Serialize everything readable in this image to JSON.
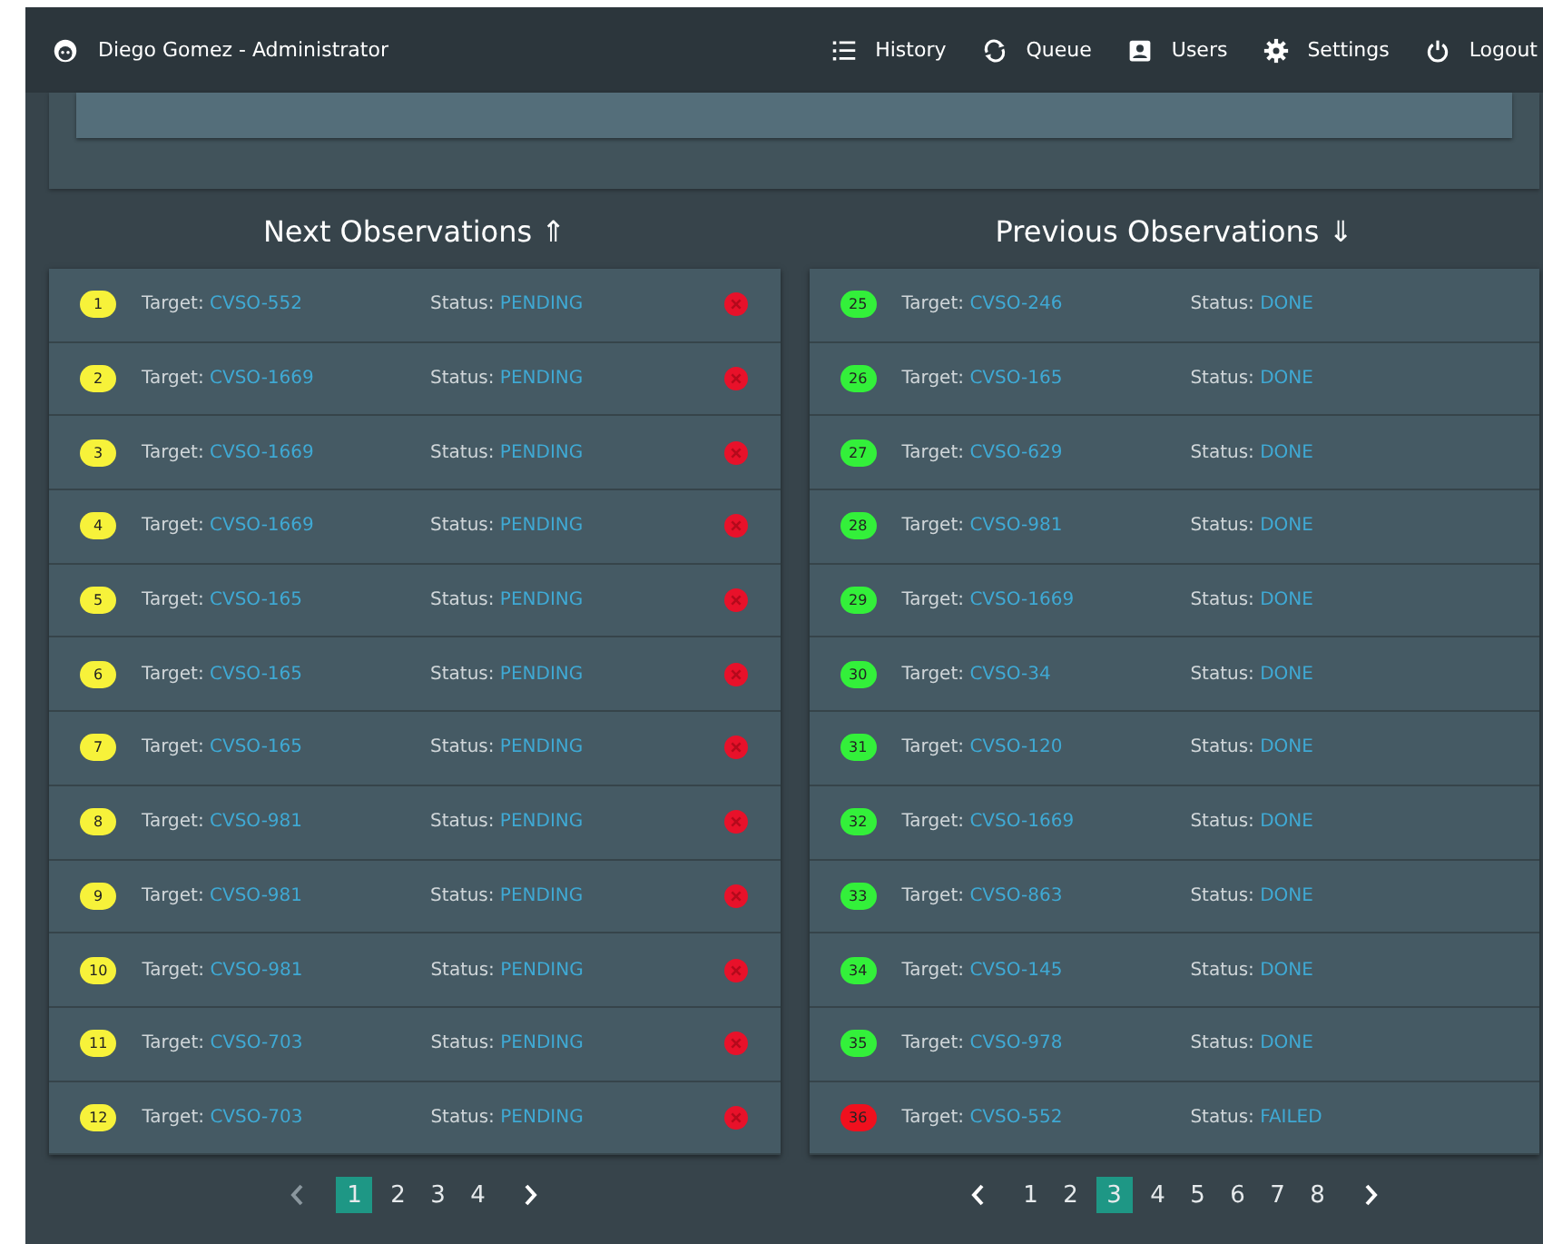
{
  "header": {
    "user": "Diego Gomez - Administrator",
    "nav": [
      {
        "label": "History"
      },
      {
        "label": "Queue"
      },
      {
        "label": "Users"
      },
      {
        "label": "Settings"
      },
      {
        "label": "Logout"
      }
    ]
  },
  "lists": [
    {
      "title": "Next Observations ⇑",
      "cancelable": true,
      "rows": [
        {
          "number": "1",
          "color": "#f7f23a",
          "target_label": "Target:",
          "target": "CVSO-552",
          "status_label": "Status:",
          "status": "PENDING"
        },
        {
          "number": "2",
          "color": "#f7f23a",
          "target_label": "Target:",
          "target": "CVSO-1669",
          "status_label": "Status:",
          "status": "PENDING"
        },
        {
          "number": "3",
          "color": "#f7f23a",
          "target_label": "Target:",
          "target": "CVSO-1669",
          "status_label": "Status:",
          "status": "PENDING"
        },
        {
          "number": "4",
          "color": "#f7f23a",
          "target_label": "Target:",
          "target": "CVSO-1669",
          "status_label": "Status:",
          "status": "PENDING"
        },
        {
          "number": "5",
          "color": "#f7f23a",
          "target_label": "Target:",
          "target": "CVSO-165",
          "status_label": "Status:",
          "status": "PENDING"
        },
        {
          "number": "6",
          "color": "#f7f23a",
          "target_label": "Target:",
          "target": "CVSO-165",
          "status_label": "Status:",
          "status": "PENDING"
        },
        {
          "number": "7",
          "color": "#f7f23a",
          "target_label": "Target:",
          "target": "CVSO-165",
          "status_label": "Status:",
          "status": "PENDING"
        },
        {
          "number": "8",
          "color": "#f7f23a",
          "target_label": "Target:",
          "target": "CVSO-981",
          "status_label": "Status:",
          "status": "PENDING"
        },
        {
          "number": "9",
          "color": "#f7f23a",
          "target_label": "Target:",
          "target": "CVSO-981",
          "status_label": "Status:",
          "status": "PENDING"
        },
        {
          "number": "10",
          "color": "#f7f23a",
          "target_label": "Target:",
          "target": "CVSO-981",
          "status_label": "Status:",
          "status": "PENDING"
        },
        {
          "number": "11",
          "color": "#f7f23a",
          "target_label": "Target:",
          "target": "CVSO-703",
          "status_label": "Status:",
          "status": "PENDING"
        },
        {
          "number": "12",
          "color": "#f7f23a",
          "target_label": "Target:",
          "target": "CVSO-703",
          "status_label": "Status:",
          "status": "PENDING"
        }
      ],
      "pagination": {
        "prev_disabled": true,
        "pages": [
          {
            "label": "1",
            "selected": true
          },
          {
            "label": "2",
            "selected": false
          },
          {
            "label": "3",
            "selected": false
          },
          {
            "label": "4",
            "selected": false
          }
        ]
      }
    },
    {
      "title": "Previous Observations ⇓",
      "cancelable": false,
      "rows": [
        {
          "number": "25",
          "color": "#33f03a",
          "target_label": "Target:",
          "target": "CVSO-246",
          "status_label": "Status:",
          "status": "DONE"
        },
        {
          "number": "26",
          "color": "#33f03a",
          "target_label": "Target:",
          "target": "CVSO-165",
          "status_label": "Status:",
          "status": "DONE"
        },
        {
          "number": "27",
          "color": "#33f03a",
          "target_label": "Target:",
          "target": "CVSO-629",
          "status_label": "Status:",
          "status": "DONE"
        },
        {
          "number": "28",
          "color": "#33f03a",
          "target_label": "Target:",
          "target": "CVSO-981",
          "status_label": "Status:",
          "status": "DONE"
        },
        {
          "number": "29",
          "color": "#33f03a",
          "target_label": "Target:",
          "target": "CVSO-1669",
          "status_label": "Status:",
          "status": "DONE"
        },
        {
          "number": "30",
          "color": "#33f03a",
          "target_label": "Target:",
          "target": "CVSO-34",
          "status_label": "Status:",
          "status": "DONE"
        },
        {
          "number": "31",
          "color": "#33f03a",
          "target_label": "Target:",
          "target": "CVSO-120",
          "status_label": "Status:",
          "status": "DONE"
        },
        {
          "number": "32",
          "color": "#33f03a",
          "target_label": "Target:",
          "target": "CVSO-1669",
          "status_label": "Status:",
          "status": "DONE"
        },
        {
          "number": "33",
          "color": "#33f03a",
          "target_label": "Target:",
          "target": "CVSO-863",
          "status_label": "Status:",
          "status": "DONE"
        },
        {
          "number": "34",
          "color": "#33f03a",
          "target_label": "Target:",
          "target": "CVSO-145",
          "status_label": "Status:",
          "status": "DONE"
        },
        {
          "number": "35",
          "color": "#33f03a",
          "target_label": "Target:",
          "target": "CVSO-978",
          "status_label": "Status:",
          "status": "DONE"
        },
        {
          "number": "36",
          "color": "#f0101e",
          "target_label": "Target:",
          "target": "CVSO-552",
          "status_label": "Status:",
          "status": "FAILED"
        }
      ],
      "pagination": {
        "prev_disabled": false,
        "pages": [
          {
            "label": "1",
            "selected": false
          },
          {
            "label": "2",
            "selected": false
          },
          {
            "label": "3",
            "selected": true
          },
          {
            "label": "4",
            "selected": false
          },
          {
            "label": "5",
            "selected": false
          },
          {
            "label": "6",
            "selected": false
          },
          {
            "label": "7",
            "selected": false
          },
          {
            "label": "8",
            "selected": false
          }
        ]
      }
    }
  ]
}
